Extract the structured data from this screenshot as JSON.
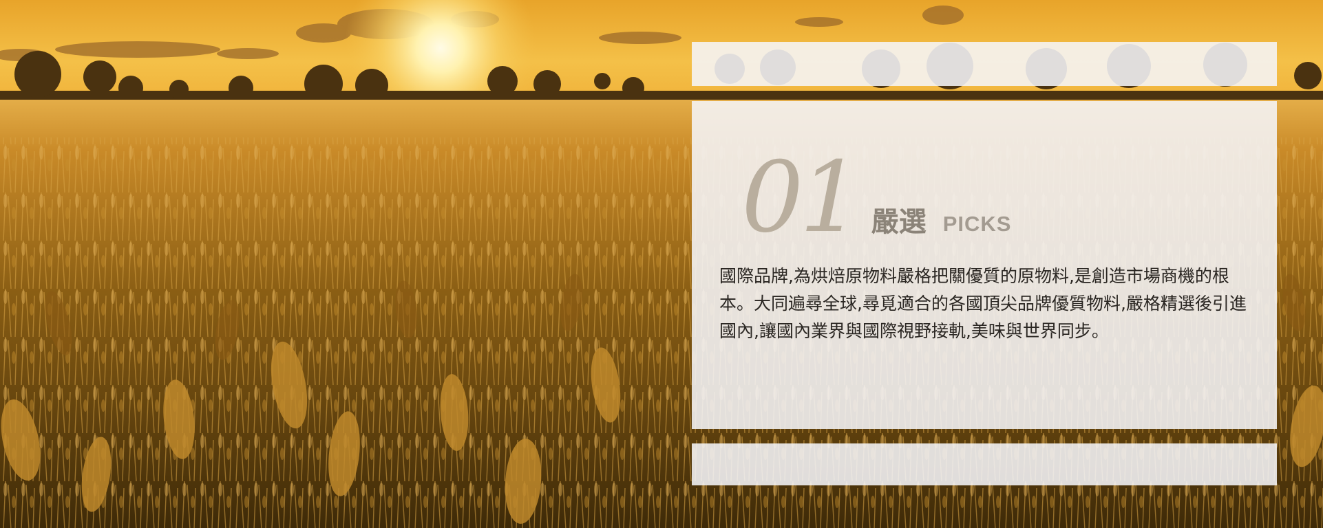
{
  "section": {
    "number": "01",
    "title_zh": "嚴選",
    "title_en": "PICKS",
    "description": "國際品牌,為烘焙原物料嚴格把關優質的原物料,是創造市場商機的根本。大同遍尋全球,尋覓適合的各國頂尖品牌優質物料,嚴格精選後引進國內,讓國內業界與國際視野接軌,美味與世界同步。"
  },
  "colors": {
    "number": "#b9ae9e",
    "title_zh": "#8b8378",
    "title_en": "#a39b91",
    "panel": "#f5f5f8",
    "sky_top": "#e8a42a",
    "field": "#8a5e14"
  },
  "background": {
    "icon": "wheat-field-sunset-image"
  }
}
